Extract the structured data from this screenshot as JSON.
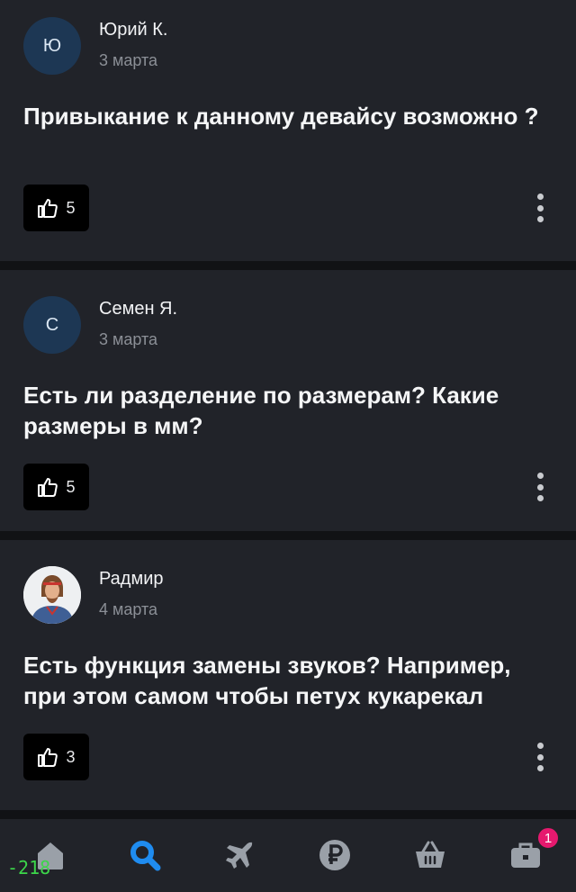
{
  "posts": [
    {
      "author": "Юрий К.",
      "avatar_initial": "Ю",
      "date": "3 марта",
      "question": "Привыкание к данному девайсу возможно ?",
      "likes": "5"
    },
    {
      "author": "Семен Я.",
      "avatar_initial": "С",
      "date": "3 марта",
      "question": "Есть ли разделение по размерам? Какие размеры в мм?",
      "likes": "5"
    },
    {
      "author": "Радмир",
      "avatar_initial": "",
      "date": "4 марта",
      "question": "Есть функция замены звуков? Например, при этом самом чтобы петух кукарекал",
      "likes": "3"
    }
  ],
  "nav": {
    "items": [
      {
        "icon": "home-icon",
        "active": false
      },
      {
        "icon": "search-icon",
        "active": true
      },
      {
        "icon": "plane-icon",
        "active": false
      },
      {
        "icon": "ruble-icon",
        "active": false
      },
      {
        "icon": "basket-icon",
        "active": false
      },
      {
        "icon": "profile-briefcase-icon",
        "active": false
      }
    ],
    "badge_count": "1",
    "active_color": "#1f8cf0",
    "inactive_color": "#9aa0a8"
  },
  "overlay_text": "-218",
  "colors": {
    "card_bg": "#212329",
    "separator": "#111215",
    "avatar_bg": "#1d3754",
    "badge": "#e6196e",
    "overlay": "#3cd64a"
  }
}
